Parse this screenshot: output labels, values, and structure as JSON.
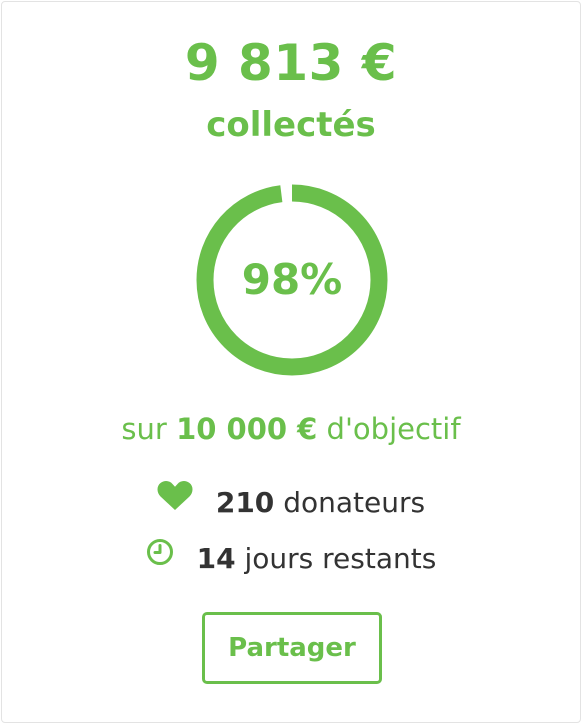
{
  "campaign": {
    "amount_collected": "9 813 €",
    "amount_label": "collectés",
    "progress_percent": 98,
    "progress_label": "98%",
    "goal_prefix": "sur",
    "goal_amount": "10 000 €",
    "goal_suffix": "d'objectif"
  },
  "stats": {
    "donors_count": "210",
    "donors_label": "donateurs",
    "days_count": "14",
    "days_label": "jours restants"
  },
  "actions": {
    "share_label": "Partager"
  },
  "icons": {
    "donors": "heart-icon",
    "days": "clock-icon"
  },
  "colors": {
    "accent": "#6abf4b",
    "text": "#333333"
  }
}
